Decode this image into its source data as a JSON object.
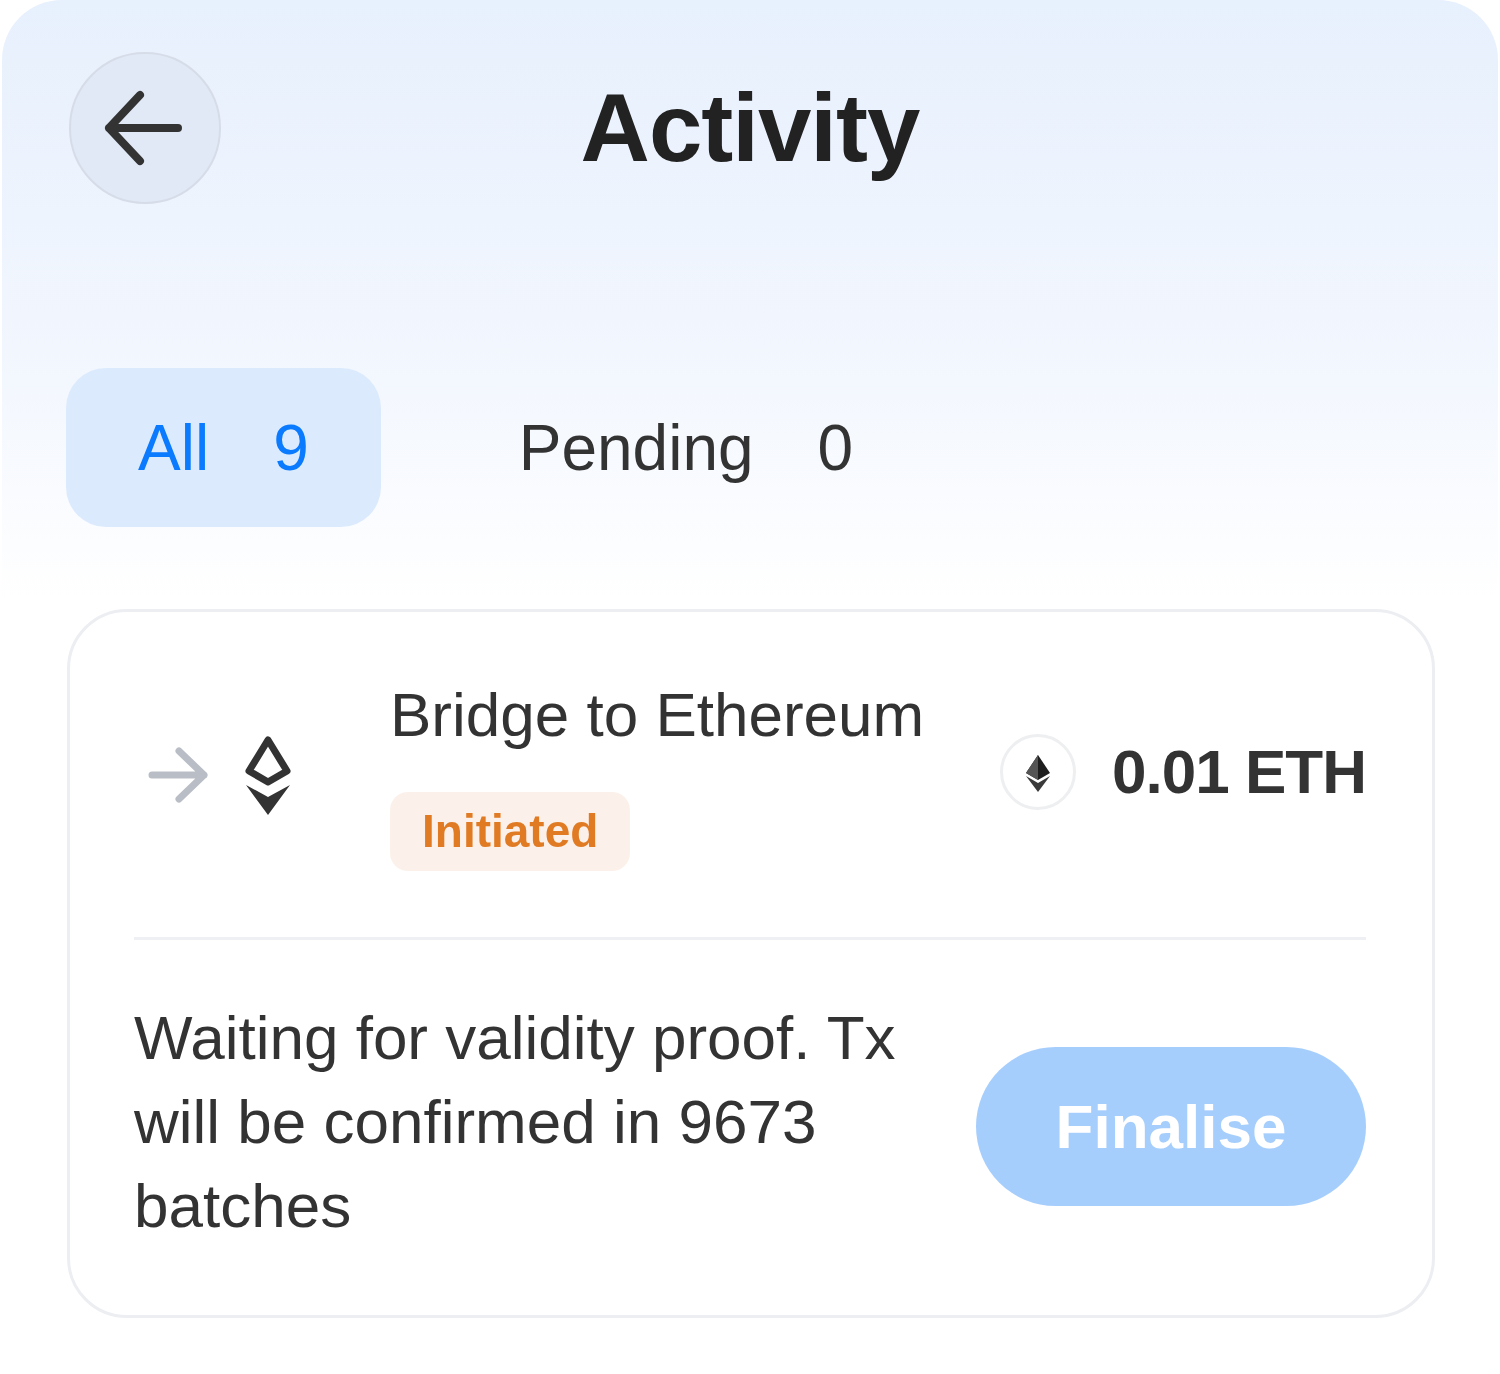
{
  "header": {
    "title": "Activity"
  },
  "tabs": [
    {
      "label": "All",
      "count": "9",
      "selected": true
    },
    {
      "label": "Pending",
      "count": "0",
      "selected": false
    }
  ],
  "transactions": [
    {
      "title": "Bridge to Ethereum",
      "status": {
        "label": "Initiated",
        "kind": "initiated"
      },
      "amount": "0.01 ETH",
      "message": "Waiting for validity proof. Tx will be confirmed in 9673 batches",
      "action": {
        "label": "Finalise",
        "disabled": true
      }
    }
  ]
}
